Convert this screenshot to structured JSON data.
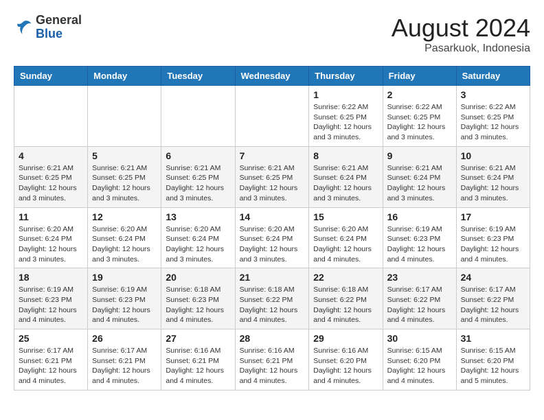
{
  "logo": {
    "general": "General",
    "blue": "Blue"
  },
  "header": {
    "month": "August 2024",
    "location": "Pasarkuok, Indonesia"
  },
  "days_of_week": [
    "Sunday",
    "Monday",
    "Tuesday",
    "Wednesday",
    "Thursday",
    "Friday",
    "Saturday"
  ],
  "weeks": [
    [
      {
        "day": "",
        "info": ""
      },
      {
        "day": "",
        "info": ""
      },
      {
        "day": "",
        "info": ""
      },
      {
        "day": "",
        "info": ""
      },
      {
        "day": "1",
        "info": "Sunrise: 6:22 AM\nSunset: 6:25 PM\nDaylight: 12 hours and 3 minutes."
      },
      {
        "day": "2",
        "info": "Sunrise: 6:22 AM\nSunset: 6:25 PM\nDaylight: 12 hours and 3 minutes."
      },
      {
        "day": "3",
        "info": "Sunrise: 6:22 AM\nSunset: 6:25 PM\nDaylight: 12 hours and 3 minutes."
      }
    ],
    [
      {
        "day": "4",
        "info": "Sunrise: 6:21 AM\nSunset: 6:25 PM\nDaylight: 12 hours and 3 minutes."
      },
      {
        "day": "5",
        "info": "Sunrise: 6:21 AM\nSunset: 6:25 PM\nDaylight: 12 hours and 3 minutes."
      },
      {
        "day": "6",
        "info": "Sunrise: 6:21 AM\nSunset: 6:25 PM\nDaylight: 12 hours and 3 minutes."
      },
      {
        "day": "7",
        "info": "Sunrise: 6:21 AM\nSunset: 6:25 PM\nDaylight: 12 hours and 3 minutes."
      },
      {
        "day": "8",
        "info": "Sunrise: 6:21 AM\nSunset: 6:24 PM\nDaylight: 12 hours and 3 minutes."
      },
      {
        "day": "9",
        "info": "Sunrise: 6:21 AM\nSunset: 6:24 PM\nDaylight: 12 hours and 3 minutes."
      },
      {
        "day": "10",
        "info": "Sunrise: 6:21 AM\nSunset: 6:24 PM\nDaylight: 12 hours and 3 minutes."
      }
    ],
    [
      {
        "day": "11",
        "info": "Sunrise: 6:20 AM\nSunset: 6:24 PM\nDaylight: 12 hours and 3 minutes."
      },
      {
        "day": "12",
        "info": "Sunrise: 6:20 AM\nSunset: 6:24 PM\nDaylight: 12 hours and 3 minutes."
      },
      {
        "day": "13",
        "info": "Sunrise: 6:20 AM\nSunset: 6:24 PM\nDaylight: 12 hours and 3 minutes."
      },
      {
        "day": "14",
        "info": "Sunrise: 6:20 AM\nSunset: 6:24 PM\nDaylight: 12 hours and 3 minutes."
      },
      {
        "day": "15",
        "info": "Sunrise: 6:20 AM\nSunset: 6:24 PM\nDaylight: 12 hours and 4 minutes."
      },
      {
        "day": "16",
        "info": "Sunrise: 6:19 AM\nSunset: 6:23 PM\nDaylight: 12 hours and 4 minutes."
      },
      {
        "day": "17",
        "info": "Sunrise: 6:19 AM\nSunset: 6:23 PM\nDaylight: 12 hours and 4 minutes."
      }
    ],
    [
      {
        "day": "18",
        "info": "Sunrise: 6:19 AM\nSunset: 6:23 PM\nDaylight: 12 hours and 4 minutes."
      },
      {
        "day": "19",
        "info": "Sunrise: 6:19 AM\nSunset: 6:23 PM\nDaylight: 12 hours and 4 minutes."
      },
      {
        "day": "20",
        "info": "Sunrise: 6:18 AM\nSunset: 6:23 PM\nDaylight: 12 hours and 4 minutes."
      },
      {
        "day": "21",
        "info": "Sunrise: 6:18 AM\nSunset: 6:22 PM\nDaylight: 12 hours and 4 minutes."
      },
      {
        "day": "22",
        "info": "Sunrise: 6:18 AM\nSunset: 6:22 PM\nDaylight: 12 hours and 4 minutes."
      },
      {
        "day": "23",
        "info": "Sunrise: 6:17 AM\nSunset: 6:22 PM\nDaylight: 12 hours and 4 minutes."
      },
      {
        "day": "24",
        "info": "Sunrise: 6:17 AM\nSunset: 6:22 PM\nDaylight: 12 hours and 4 minutes."
      }
    ],
    [
      {
        "day": "25",
        "info": "Sunrise: 6:17 AM\nSunset: 6:21 PM\nDaylight: 12 hours and 4 minutes."
      },
      {
        "day": "26",
        "info": "Sunrise: 6:17 AM\nSunset: 6:21 PM\nDaylight: 12 hours and 4 minutes."
      },
      {
        "day": "27",
        "info": "Sunrise: 6:16 AM\nSunset: 6:21 PM\nDaylight: 12 hours and 4 minutes."
      },
      {
        "day": "28",
        "info": "Sunrise: 6:16 AM\nSunset: 6:21 PM\nDaylight: 12 hours and 4 minutes."
      },
      {
        "day": "29",
        "info": "Sunrise: 6:16 AM\nSunset: 6:20 PM\nDaylight: 12 hours and 4 minutes."
      },
      {
        "day": "30",
        "info": "Sunrise: 6:15 AM\nSunset: 6:20 PM\nDaylight: 12 hours and 4 minutes."
      },
      {
        "day": "31",
        "info": "Sunrise: 6:15 AM\nSunset: 6:20 PM\nDaylight: 12 hours and 5 minutes."
      }
    ]
  ]
}
